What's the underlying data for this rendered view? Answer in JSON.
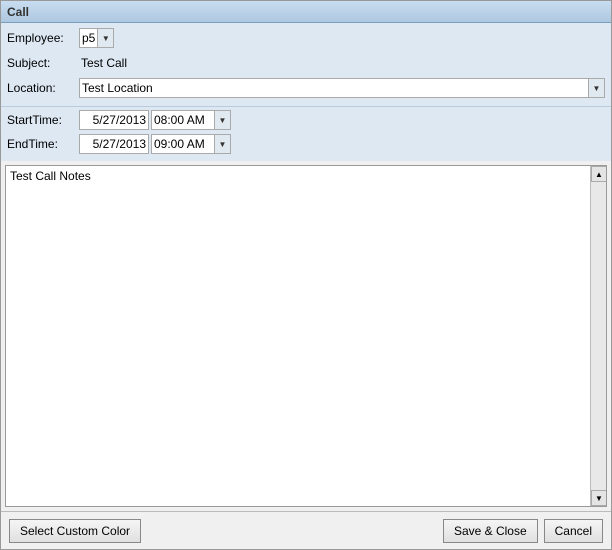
{
  "window": {
    "title": "Call"
  },
  "form": {
    "employee_label": "Employee:",
    "employee_value": "p5",
    "subject_label": "Subject:",
    "subject_value": "Test Call",
    "location_label": "Location:",
    "location_value": "Test Location",
    "start_time_label": "StartTime:",
    "start_date": "5/27/2013",
    "start_time": "08:00 AM",
    "end_time_label": "EndTime:",
    "end_date": "5/27/2013",
    "end_time": "09:00 AM",
    "notes_value": "Test Call Notes"
  },
  "buttons": {
    "custom_color": "Select Custom Color",
    "save_close": "Save & Close",
    "cancel": "Cancel"
  },
  "icons": {
    "dropdown_arrow": "▼",
    "scroll_up": "▲",
    "scroll_down": "▼"
  }
}
